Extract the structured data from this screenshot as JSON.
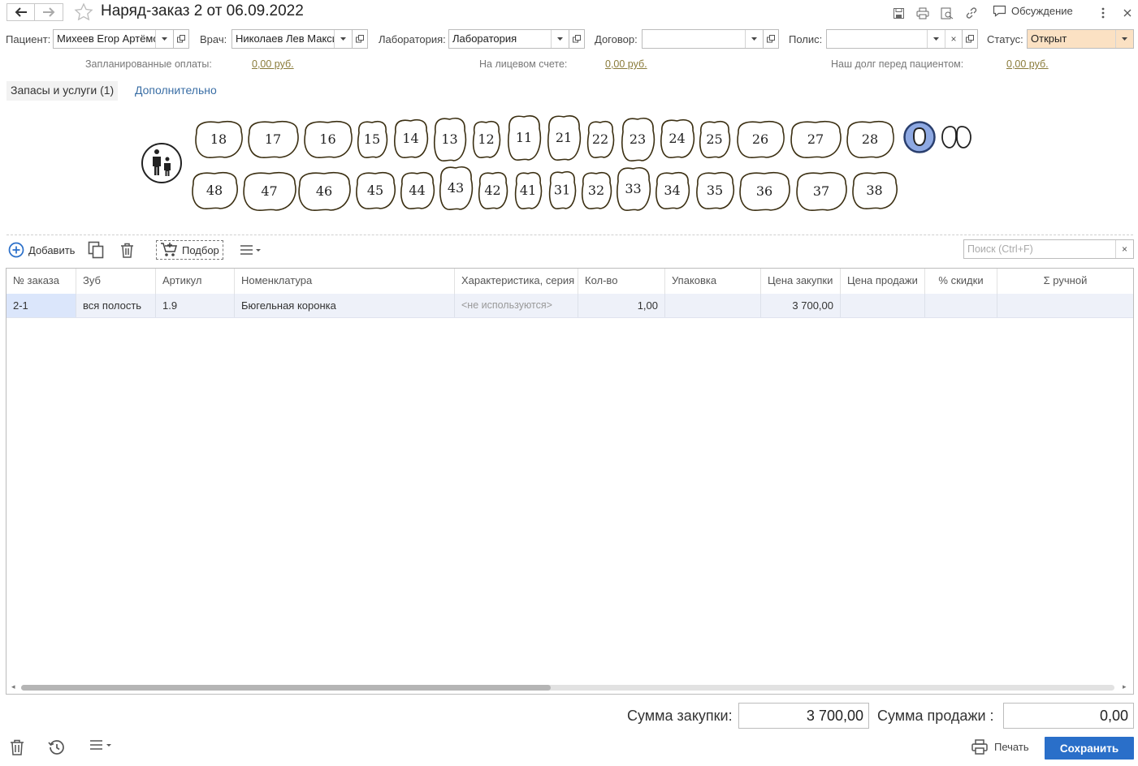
{
  "window": {
    "title": "Наряд-заказ 2 от 06.09.2022",
    "discuss_label": "Обсуждение",
    "icons": [
      "back-arrow-icon",
      "forward-arrow-icon",
      "star-icon",
      "save-icon",
      "print-icon",
      "preview-icon",
      "link-icon",
      "chat-icon",
      "more-vertical-icon",
      "close-icon"
    ]
  },
  "header": {
    "patient": {
      "label": "Пациент:",
      "value": "Михеев Егор Артёмович"
    },
    "doctor": {
      "label": "Врач:",
      "value": "Николаев Лев Максимович"
    },
    "lab": {
      "label": "Лаборатория:",
      "value": "Лаборатория"
    },
    "contract": {
      "label": "Договор:",
      "value": ""
    },
    "policy": {
      "label": "Полис:",
      "value": ""
    },
    "status": {
      "label": "Статус:",
      "value": "Открыт",
      "color": "#fbe1c3"
    }
  },
  "info": {
    "planned_label": "Запланированные оплаты:",
    "planned_value": "0,00 руб.",
    "account_label": "На лицевом счете:",
    "account_value": "0,00 руб.",
    "debt_label": "Наш долг перед пациентом:",
    "debt_value": "0,00 руб."
  },
  "tabs": {
    "active": "Запасы и услуги (1)",
    "other": "Дополнительно"
  },
  "teeth": {
    "upper": [
      "18",
      "17",
      "16",
      "15",
      "14",
      "13",
      "12",
      "11",
      "21",
      "22",
      "23",
      "24",
      "25",
      "26",
      "27",
      "28"
    ],
    "lower": [
      "48",
      "47",
      "46",
      "45",
      "44",
      "43",
      "42",
      "41",
      "31",
      "32",
      "33",
      "34",
      "35",
      "36",
      "37",
      "38"
    ],
    "selection_color": "#8ea9e3"
  },
  "toolbar": {
    "add_label": "Добавить",
    "pick_label": "Подбор",
    "search_placeholder": "Поиск (Ctrl+F)",
    "search_clear": "×"
  },
  "table": {
    "columns": [
      "№ заказа",
      "Зуб",
      "Артикул",
      "Номенклатура",
      "Характеристика, серия",
      "Кол-во",
      "Упаковка",
      "Цена закупки",
      "Цена продажи",
      "% скидки",
      "Σ ручной"
    ],
    "rows": [
      [
        "2-1",
        "вся полость",
        "1.9",
        "Бюгельная коронка",
        "<не используются>",
        "1,00",
        "",
        "3 700,00",
        "",
        "",
        ""
      ]
    ]
  },
  "totals": {
    "purchase_label": "Сумма закупки:",
    "purchase_value": "3 700,00",
    "sale_label": "Сумма продажи :",
    "sale_value": "0,00"
  },
  "footer": {
    "print_label": "Печать",
    "save_label": "Сохранить"
  }
}
